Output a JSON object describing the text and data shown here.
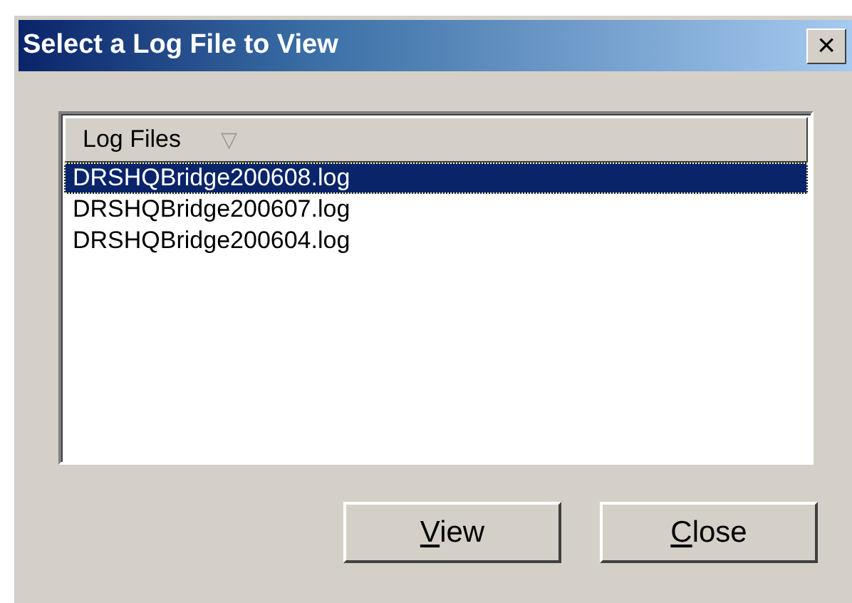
{
  "window": {
    "title": "Select a Log File to View",
    "close_symbol": "×"
  },
  "list": {
    "column": {
      "label": "Log Files",
      "sort_symbol": "▽"
    },
    "rows": [
      {
        "label": "DRSHQBridge200608.log",
        "selected": true
      },
      {
        "label": "DRSHQBridge200607.log",
        "selected": false
      },
      {
        "label": "DRSHQBridge200604.log",
        "selected": false
      }
    ]
  },
  "buttons": [
    {
      "label": "View"
    },
    {
      "label": "Close"
    }
  ]
}
